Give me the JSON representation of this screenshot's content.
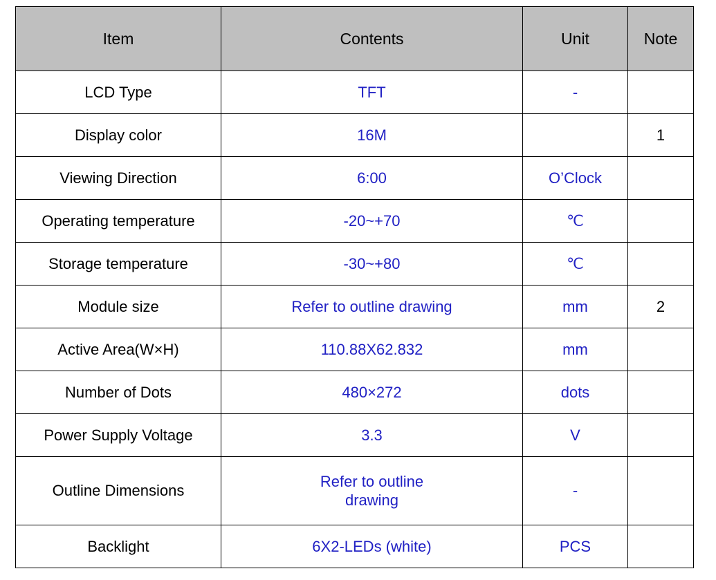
{
  "table": {
    "headers": {
      "item": "Item",
      "contents": "Contents",
      "unit": "Unit",
      "note": "Note"
    },
    "colors": {
      "header_background": "#bfbfbf",
      "header_text": "#000000",
      "value_text": "#2121c4",
      "item_text": "#000000",
      "border": "#000000",
      "page_background": "#ffffff"
    },
    "rows": [
      {
        "item": "LCD Type",
        "contents": "TFT",
        "unit": "-",
        "note": ""
      },
      {
        "item": "Display color",
        "contents": "16M",
        "unit": "",
        "note": "1"
      },
      {
        "item": "Viewing Direction",
        "contents": "6:00",
        "unit": "O’Clock",
        "note": ""
      },
      {
        "item": "Operating temperature",
        "contents": "-20~+70",
        "unit": "℃",
        "note": ""
      },
      {
        "item": "Storage temperature",
        "contents": "-30~+80",
        "unit": "℃",
        "note": ""
      },
      {
        "item": "Module size",
        "contents": "Refer to outline drawing",
        "unit": "mm",
        "note": "2"
      },
      {
        "item": "Active Area(W×H)",
        "contents": "110.88X62.832",
        "unit": "mm",
        "note": ""
      },
      {
        "item": "Number of Dots",
        "contents": "480×272",
        "unit": "dots",
        "note": ""
      },
      {
        "item": "Power Supply Voltage",
        "contents": "3.3",
        "unit": "V",
        "note": ""
      },
      {
        "item": "Outline Dimensions",
        "contents_line1": "Refer to outline",
        "contents_line2": "drawing",
        "unit": "-",
        "note": "",
        "tall": true
      },
      {
        "item": "Backlight",
        "contents": "6X2-LEDs (white)",
        "unit": "PCS",
        "note": ""
      }
    ]
  }
}
